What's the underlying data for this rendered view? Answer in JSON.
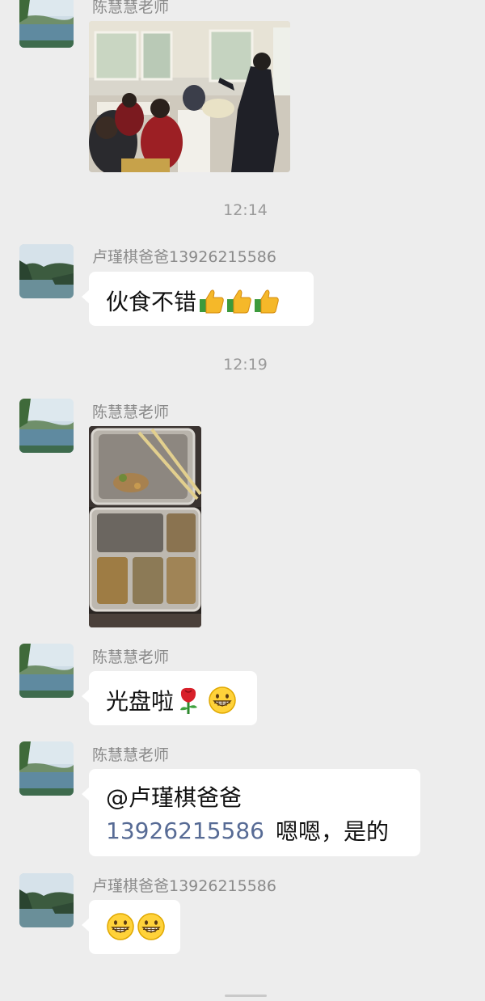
{
  "messages": {
    "m1": {
      "sender": "陈慧慧老师"
    },
    "t1": {
      "time": "12:14"
    },
    "m2": {
      "sender": "卢瑾棋爸爸13926215586",
      "text": "伙食不错"
    },
    "t2": {
      "time": "12:19"
    },
    "m3": {
      "sender": "陈慧慧老师"
    },
    "m4": {
      "sender": "陈慧慧老师",
      "text": "光盘啦"
    },
    "m5": {
      "sender": "陈慧慧老师",
      "mention": "@卢瑾棋爸爸",
      "mention_number": "13926215586",
      "reply": "嗯嗯，是的"
    },
    "m6": {
      "sender": "卢瑾棋爸爸13926215586"
    }
  },
  "icons": {
    "thumbs_up": "thumbs-up-emoji",
    "rose": "rose-emoji",
    "grin": "grinning-face-emoji"
  },
  "colors": {
    "background": "#ededed",
    "bubble": "#ffffff",
    "mention_link": "#576b95"
  }
}
